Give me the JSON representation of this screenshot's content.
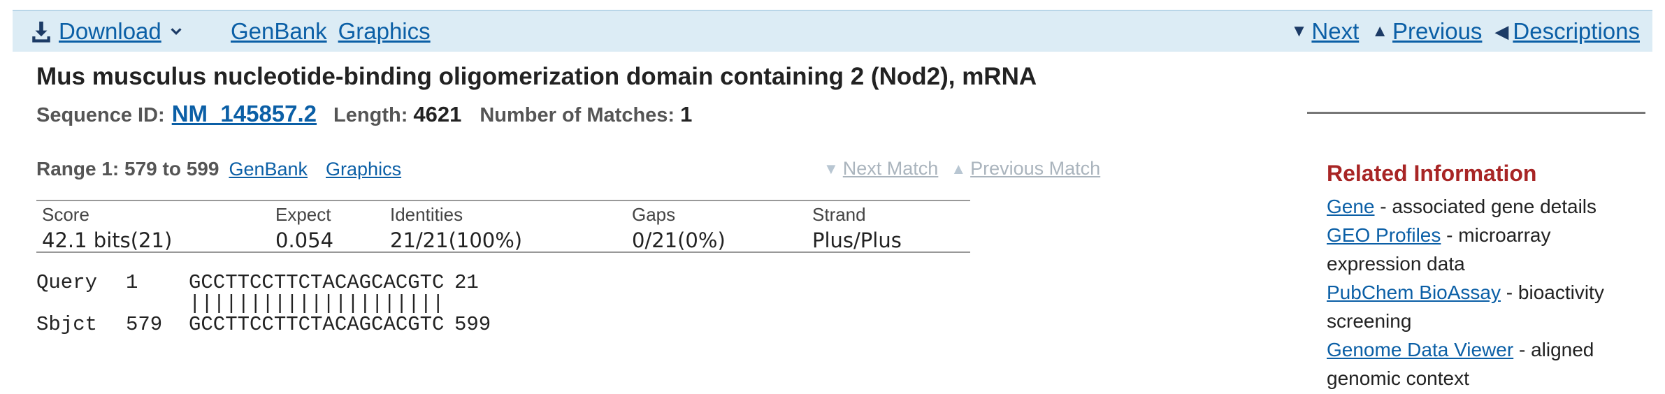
{
  "toolbar": {
    "download_label": "Download",
    "genbank_label": "GenBank",
    "graphics_label": "Graphics",
    "next_label": "Next",
    "previous_label": "Previous",
    "descriptions_label": "Descriptions"
  },
  "record": {
    "title": "Mus musculus nucleotide-binding oligomerization domain containing 2 (Nod2), mRNA",
    "sequence_id_label": "Sequence ID:",
    "sequence_id": "NM_145857.2",
    "length_label": "Length:",
    "length": "4621",
    "matches_label": "Number of Matches:",
    "matches": "1"
  },
  "range": {
    "label": "Range 1: 579 to 599",
    "genbank_label": "GenBank",
    "graphics_label": "Graphics",
    "next_match_label": "Next Match",
    "previous_match_label": "Previous Match"
  },
  "score_table": {
    "headers": [
      "Score",
      "Expect",
      "Identities",
      "Gaps",
      "Strand"
    ],
    "values": [
      "42.1 bits(21)",
      "0.054",
      "21/21(100%)",
      "0/21(0%)",
      "Plus/Plus"
    ]
  },
  "alignment": {
    "query": {
      "label": "Query",
      "start": "1",
      "seq": "GCCTTCCTTCTACAGCACGTC",
      "end": "21"
    },
    "match_line": "|||||||||||||||||||||",
    "sbjct": {
      "label": "Sbjct",
      "start": "579",
      "seq": "GCCTTCCTTCTACAGCACGTC",
      "end": "599"
    }
  },
  "related": {
    "heading": "Related Information",
    "items": [
      {
        "link": "Gene",
        "desc": " - associated gene details"
      },
      {
        "link": "GEO Profiles",
        "desc": " - microarray expression data"
      },
      {
        "link": "PubChem BioAssay",
        "desc": " - bioactivity screening"
      },
      {
        "link": "Genome Data Viewer",
        "desc": " - aligned genomic context"
      }
    ]
  },
  "colors": {
    "toolbar_bg": "#dcecf5",
    "link": "#0b5fa6",
    "related_heading": "#a82525",
    "disabled": "#aab4bd"
  },
  "icons": {
    "download": "download-icon",
    "chevron": "chevron-down-icon",
    "next": "triangle-down-icon",
    "previous": "triangle-up-icon",
    "descriptions": "arrow-left-icon"
  }
}
